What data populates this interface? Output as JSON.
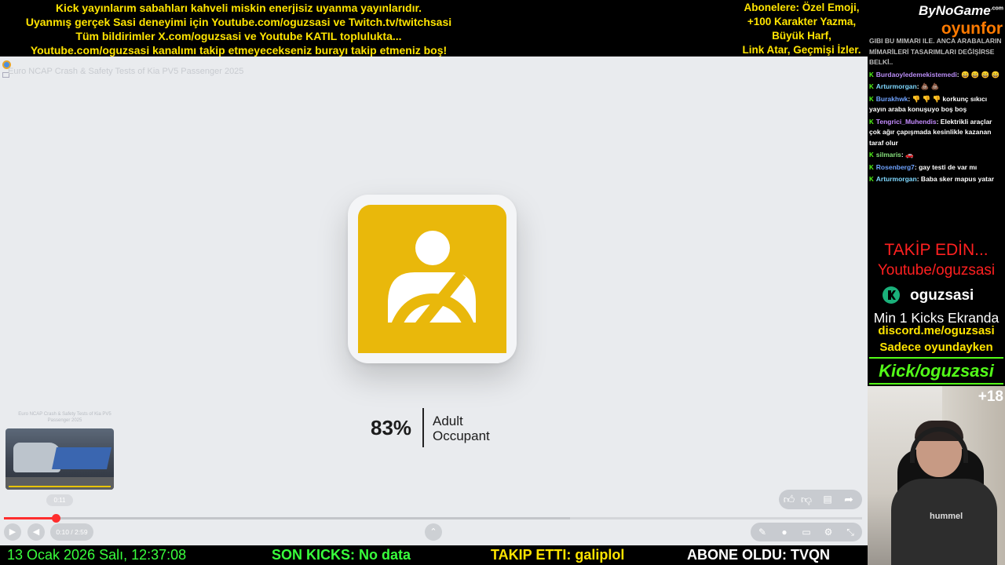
{
  "banner": {
    "left_lines": [
      "Kick yayınlarım sabahları kahveli miskin enerjisiz uyanma yayınlarıdır.",
      "Uyanmış gerçek Sasi deneyimi için Youtube.com/oguzsasi ve Twitch.tv/twitchsasi",
      "Tüm bildirimler X.com/oguzsasi ve Youtube KATIL toplulukta...",
      "Youtube.com/oguzsasi kanalımı takip etmeyecekseniz burayı takip etmeniz boş!"
    ],
    "right_lines": [
      "Abonelere: Özel Emoji,",
      "+100 Karakter Yazma,",
      "Büyük Harf,",
      "Link Atar, Geçmişi İzler."
    ]
  },
  "video": {
    "title": "Euro NCAP Crash & Safety Tests of Kia PV5 Passenger 2025",
    "score_percent": "83%",
    "score_label_line1": "Adult",
    "score_label_line2": "Occupant",
    "thumbnail_label": "Euro NCAP Crash & Safety Tests of Kia PV5 Passenger 2025",
    "thumbnail_time": "0:11",
    "time_display": "0:10 / 2:59",
    "progress_fraction": 0.06,
    "buffer_fraction": 0.66,
    "icons": {
      "play": "play-icon",
      "volume": "volume-icon",
      "expand": "chevron-up-icon",
      "like": "thumbs-up-icon",
      "dislike": "thumbs-down-icon",
      "comment": "comment-icon",
      "share": "share-icon",
      "pen": "pen-icon",
      "toggle": "autoplay-toggle-icon",
      "miniplayer": "miniplayer-icon",
      "settings": "gear-icon",
      "fullscreen": "exit-fullscreen-icon"
    },
    "colors": {
      "accent": "#e9b80b",
      "progress": "#ff2d2d"
    }
  },
  "ticker": {
    "date": "13 Ocak 2026 Salı, 12:37:08",
    "kicks": "SON KICKS: No data",
    "follow": "TAKIP ETTI: galiplol",
    "subscriber": "ABONE OLDU: TVQN"
  },
  "sidebar": {
    "logo_top": "ByNoGame",
    "logo_top_sup": ".com",
    "logo_bottom": "oyunfor",
    "chat_cut_text": "GIBI BU MIMARI ILE. ANCA ARABALARIN MİMARİLERİ TASARIMLARI DEĞİŞİRSE BELKİ..",
    "chat": [
      {
        "user": "Burdaoyledemekistemedi",
        "color": "#b98cf5",
        "text": ": 😄 😄 😄 😄"
      },
      {
        "user": "Arturmorgan",
        "color": "#7fd8ff",
        "text": ": 💩 💩"
      },
      {
        "user": "Burakhwk",
        "color": "#6fa3ff",
        "text": ": 👎 👎 👎  korkunç sıkıcı yayın araba konuşuyo boş boş"
      },
      {
        "user": "Tengrici_Muhendis",
        "color": "#c58cff",
        "text": ": Elektrikli araçlar çok ağır çapışmada kesinlikle kazanan taraf olur"
      },
      {
        "user": "silmaris",
        "color": "#86e07c",
        "text": ": 🚗"
      },
      {
        "user": "Rosenberg7",
        "color": "#6fa3ff",
        "text": ": gay testi de var mı"
      },
      {
        "user": "Arturmorgan",
        "color": "#7fd8ff",
        "text": ": Baba sker mapus yatar"
      }
    ],
    "takip": "TAKİP EDİN...",
    "youtube": "Youtube/oguzsasi",
    "kick_name": "oguzsasi",
    "kicks_line": "Min 1 Kicks Ekranda",
    "discord": "discord.me/oguzsasi",
    "sadece": "Sadece oyundayken",
    "kick_banner": "Kick/oguzsasi",
    "age_badge": "+18",
    "webcam_shirt_text": "hummel"
  }
}
